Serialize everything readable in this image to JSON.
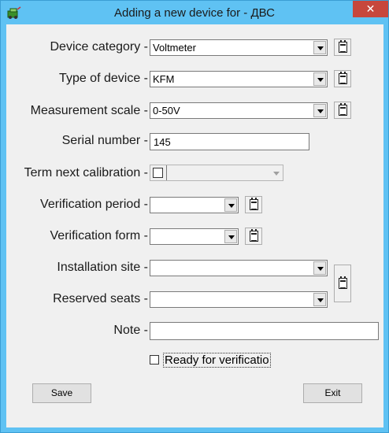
{
  "window": {
    "title": "Adding a new device for - ДВС",
    "close_glyph": "✕",
    "icon": "app-icon"
  },
  "colors": {
    "titlebar": "#5fc2f3",
    "close": "#c7473c",
    "client": "#f0f0f0"
  },
  "form": {
    "device_category": {
      "label": "Device category -",
      "value": "Voltmeter",
      "icon": "notepad-icon"
    },
    "device_type": {
      "label": "Type of device -",
      "value": "KFM",
      "icon": "notepad-icon"
    },
    "measurement_scale": {
      "label": "Measurement scale -",
      "value": "0-50V",
      "icon": "notepad-icon"
    },
    "serial_number": {
      "label": "Serial number -",
      "value": "145"
    },
    "term_next_calibration": {
      "label": "Term next calibration -",
      "checked": false,
      "value": ""
    },
    "verification_period": {
      "label": "Verification period -",
      "value": "",
      "icon": "notepad-icon"
    },
    "verification_form": {
      "label": "Verification form -",
      "value": "",
      "icon": "notepad-icon"
    },
    "installation_site": {
      "label": "Installation site -",
      "value": ""
    },
    "reserved_seats": {
      "label": "Reserved seats -",
      "value": ""
    },
    "note": {
      "label": "Note -",
      "value": ""
    },
    "ready_for_verification": {
      "label": "Ready for verificatio",
      "checked": false
    }
  },
  "buttons": {
    "save": "Save",
    "exit": "Exit"
  }
}
